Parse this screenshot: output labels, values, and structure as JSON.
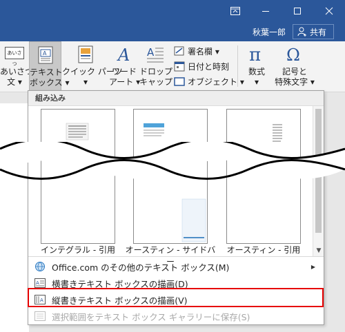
{
  "user": {
    "name": "秋葉一郎",
    "share_label": "共有"
  },
  "ribbon": {
    "aisatsu": {
      "icon_text": "あいさつ",
      "line1": "あいさつ",
      "line2": "文 ▾"
    },
    "textbox": {
      "line1": "テキスト",
      "line2": "ボックス ▾"
    },
    "quickparts": {
      "line1": "クイック パーツ",
      "line2": "▾"
    },
    "wordart": {
      "line1": "ワード",
      "line2": "アート ▾"
    },
    "dropcap": {
      "line1": "ドロップ",
      "line2": "キャップ ▾"
    },
    "signature": "署名欄 ▾",
    "datetime": "日付と時刻",
    "object": "オブジェクト ▾",
    "equation": {
      "line1": "数式",
      "line2": "▾"
    },
    "symbol": {
      "line1": "記号と",
      "line2": "特殊文字 ▾"
    }
  },
  "gallery": {
    "header": "組み込み",
    "thumbnails": [
      {
        "label": "インテグラル - 引用"
      },
      {
        "label": "オースティン - サイドバー"
      },
      {
        "label": "オースティン - 引用"
      }
    ],
    "menu": [
      {
        "label": "Office.com のその他のテキスト ボックス(M)",
        "enabled": true,
        "submenu": true
      },
      {
        "label": "横書きテキスト ボックスの描画(D)",
        "enabled": true
      },
      {
        "label": "縦書きテキスト ボックスの描画(V)",
        "enabled": true,
        "highlighted": true
      },
      {
        "label": "選択範囲をテキスト ボックス ギャラリーに保存(S)",
        "enabled": false
      }
    ]
  },
  "colors": {
    "titlebar": "#2b579a",
    "highlight": "#e60000"
  }
}
